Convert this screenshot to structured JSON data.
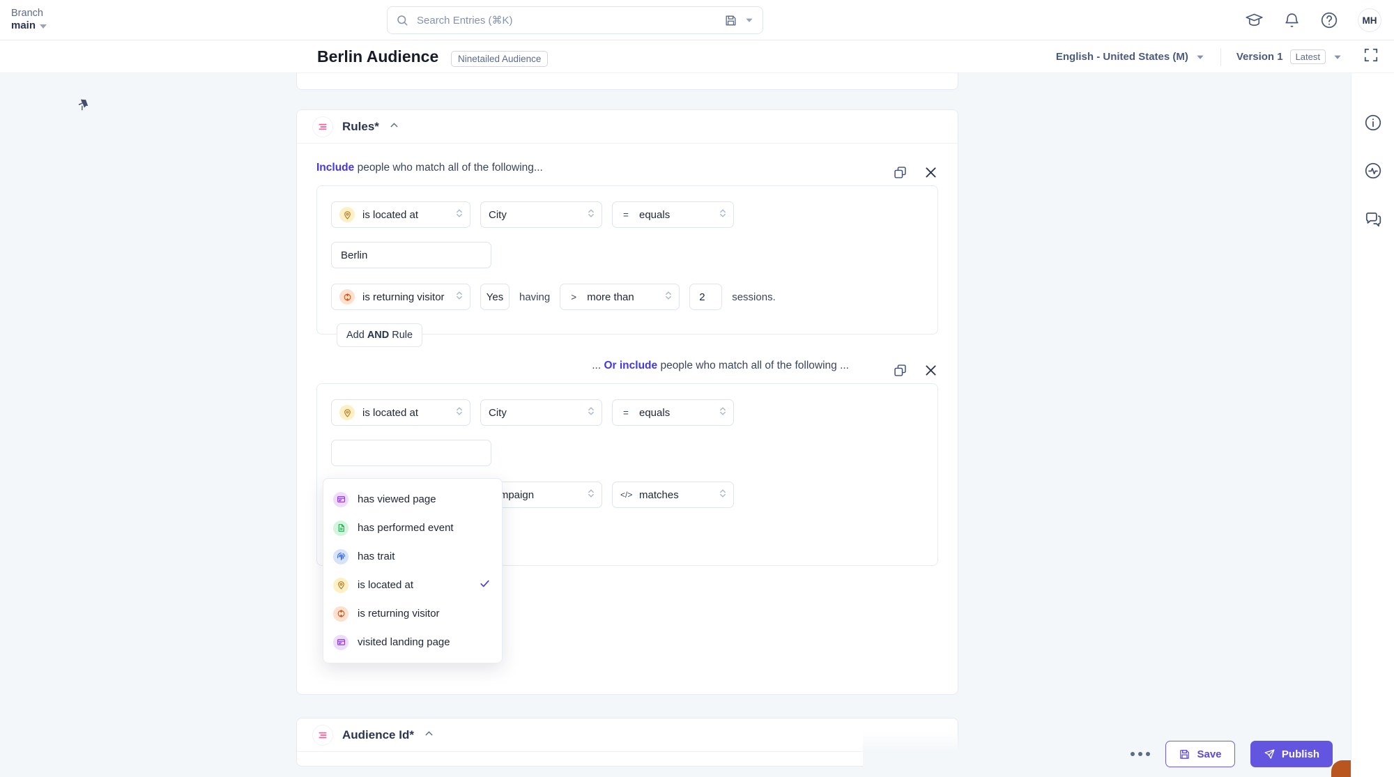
{
  "topbar": {
    "branch_label": "Branch",
    "branch_name": "main",
    "search_placeholder": "Search Entries (⌘K)",
    "search_value": "",
    "icons": [
      "save-entry-icon",
      "chevron-down-icon",
      "graduation-cap-icon",
      "bell-icon",
      "help-icon"
    ],
    "avatar_initials": "MH"
  },
  "header": {
    "title": "Berlin Audience",
    "badge": "Ninetailed Audience",
    "locale": "English - United States (M)",
    "version": "Version 1",
    "version_pill": "Latest"
  },
  "rules_section": {
    "title": "Rules*",
    "include_keyword": "Include",
    "include_rest": " people who match all of the following...",
    "or_prefix": "... ",
    "or_keyword": "Or include",
    "or_rest": " people who match all of the following ...",
    "add_and_prefix": "Add ",
    "add_and_bold": "AND",
    "add_and_suffix": " Rule",
    "group1": {
      "row1": {
        "attribute": "is located at",
        "attribute_icon": "map-pin-icon",
        "property": "City",
        "operator_symbol": "=",
        "operator": "equals",
        "value": "Berlin"
      },
      "row2": {
        "attribute": "is returning visitor",
        "attribute_icon": "returning-visitor-icon",
        "value": "Yes",
        "having_label": "having",
        "comparator_symbol": ">",
        "comparator": "more than",
        "count": "2",
        "sessions_label": "sessions."
      }
    },
    "group2": {
      "row1": {
        "attribute": "is located at",
        "attribute_icon": "map-pin-icon",
        "property": "City",
        "operator_symbol": "=",
        "operator": "equals"
      },
      "row2": {
        "property": "campaign",
        "operator_symbol": "</>",
        "operator": "matches"
      }
    }
  },
  "attribute_menu": {
    "items": [
      {
        "label": "has viewed page",
        "icon": "browser-window-icon",
        "icon_color": "c-purple",
        "selected": false
      },
      {
        "label": "has performed event",
        "icon": "event-document-icon",
        "icon_color": "c-green",
        "selected": false
      },
      {
        "label": "has trait",
        "icon": "fingerprint-icon",
        "icon_color": "c-blue",
        "selected": false
      },
      {
        "label": "is located at",
        "icon": "map-pin-icon",
        "icon_color": "c-yellow",
        "selected": true
      },
      {
        "label": "is returning visitor",
        "icon": "returning-visitor-icon",
        "icon_color": "c-orange",
        "selected": false
      },
      {
        "label": "visited landing page",
        "icon": "browser-window-icon",
        "icon_color": "c-purple",
        "selected": false
      }
    ]
  },
  "audience_id_section": {
    "title": "Audience Id*"
  },
  "actionbar": {
    "more_label": "more-options",
    "save_label": "Save",
    "publish_label": "Publish"
  },
  "colors": {
    "accent": "#4338e8",
    "publish": "#6355e0",
    "section_icon": "#fa5f94"
  }
}
